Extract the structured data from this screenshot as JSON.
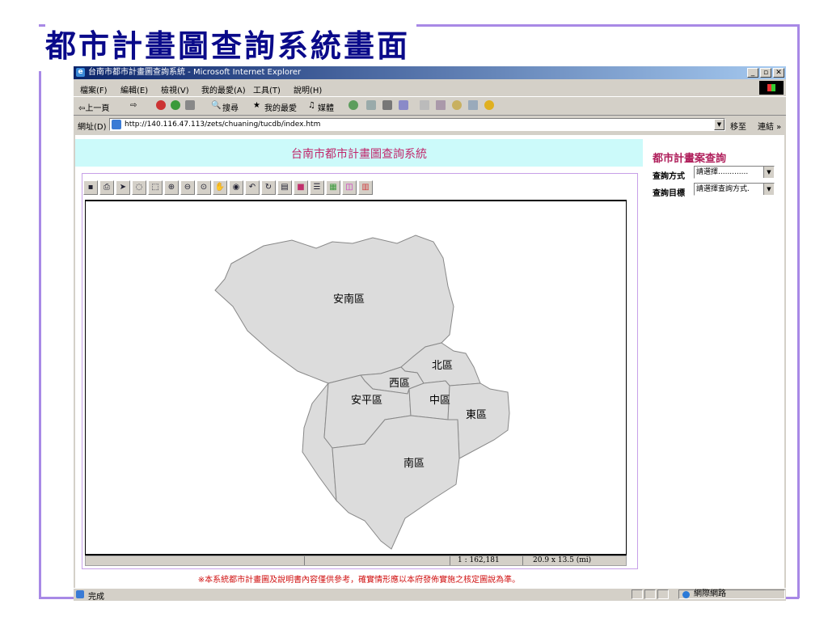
{
  "slide": {
    "title": "都市計畫圖查詢系統畫面"
  },
  "window": {
    "title": "台南市都市計畫圖查詢系統 - Microsoft Internet Explorer",
    "controls": [
      "_",
      "▫",
      "✕"
    ]
  },
  "menu": [
    {
      "label": "檔案(F)"
    },
    {
      "label": "編輯(E)"
    },
    {
      "label": "檢視(V)"
    },
    {
      "label": "我的最愛(A)"
    },
    {
      "label": "工具(T)"
    },
    {
      "label": "說明(H)"
    }
  ],
  "toolbar": {
    "back": "⇦上一頁",
    "search": "搜尋",
    "favorites": "我的最愛",
    "media": "媒體"
  },
  "address": {
    "label": "網址(D)",
    "url": "http://140.116.47.113/zets/chuaning/tucdb/index.htm",
    "go": "移至",
    "links": "連結 »"
  },
  "page": {
    "header": "台南市都市計畫圖查詢系統",
    "side_panel": {
      "title": "都市計畫案查詢",
      "query_method_label": "查詢方式",
      "query_method_value": "請選擇.............",
      "query_target_label": "查詢目標",
      "query_target_value": "請選擇查詢方式."
    },
    "map": {
      "districts": [
        {
          "name": "安南區"
        },
        {
          "name": "北區"
        },
        {
          "name": "西區"
        },
        {
          "name": "安平區"
        },
        {
          "name": "中區"
        },
        {
          "name": "東區"
        },
        {
          "name": "南區"
        }
      ],
      "scale": "1 : 162,181",
      "dimensions": "20.9 x 13.5 (mi)"
    },
    "disclaimer": "※本系統都市計畫圖及說明書內容僅供參考，確實情形應以本府發佈實施之核定圖說為準。"
  },
  "statusbar": {
    "text": "完成",
    "zone": "網際網路"
  }
}
